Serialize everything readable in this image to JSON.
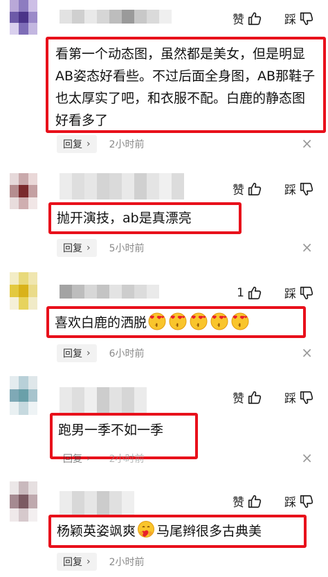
{
  "comments": [
    {
      "text": "看第一个动态图，虽然都是美女，但是明显AB姿态好看些。不过后面全身图，AB那鞋子也太厚实了吧，和衣服不配。白鹿的静态图好看多了",
      "like_label": "赞",
      "dislike_label": "踩",
      "reply_label": "回复",
      "reply_chevron": "›",
      "time": "2小时前",
      "close": "×"
    },
    {
      "text": "抛开演技，ab是真漂亮",
      "like_label": "赞",
      "dislike_label": "踩",
      "reply_label": "回复",
      "reply_chevron": "›",
      "time": "5小时前",
      "close": "×"
    },
    {
      "text": "喜欢白鹿的洒脱",
      "emojis": [
        "kiss-heart-emoji",
        "kiss-heart-emoji",
        "kiss-heart-emoji",
        "kiss-heart-emoji",
        "kiss-heart-emoji"
      ],
      "like_label": "1",
      "dislike_label": "踩",
      "reply_label": "回复",
      "reply_chevron": "›",
      "time": "6小时前",
      "close": "×"
    },
    {
      "text": "跑男一季不如一季",
      "like_label": "赞",
      "dislike_label": "踩",
      "reply_label": "回复",
      "reply_chevron": "›",
      "time": "2小时前",
      "close": "×"
    },
    {
      "text_before": "杨颖英姿飒爽",
      "emoji": "hug-heart-emoji",
      "text_after": "马尾辫很多古典美",
      "like_label": "赞",
      "dislike_label": "踩",
      "reply_label": "回复",
      "reply_chevron": "›",
      "time": "2小时前"
    }
  ],
  "colors": {
    "highlight_border": "#e8101b",
    "reply_bg": "#f2f2f2",
    "time_text": "#8a8a8a"
  }
}
